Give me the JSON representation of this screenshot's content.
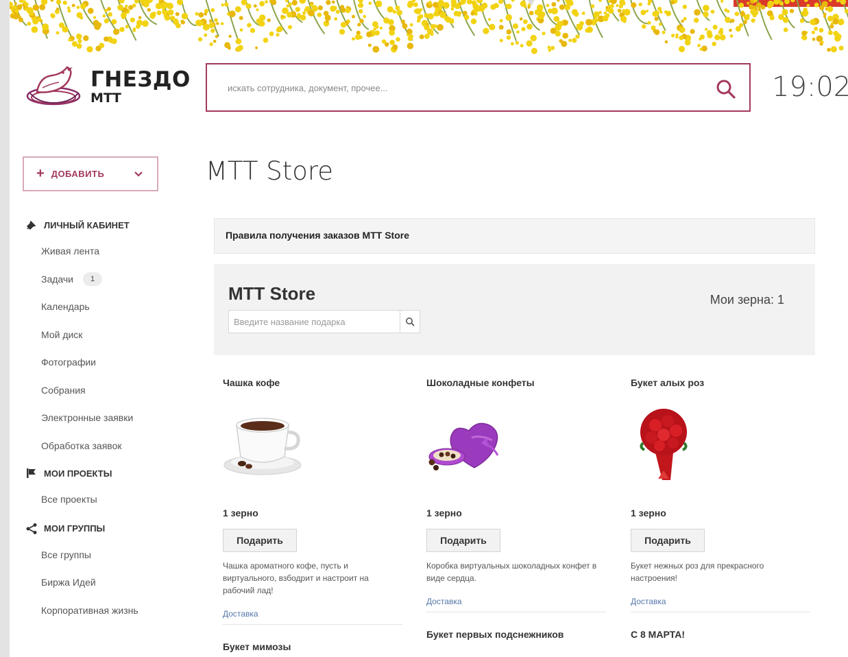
{
  "header": {
    "logo_title": "ГНЕЗДО",
    "logo_sub": "МТТ",
    "search_placeholder": "искать сотрудника, документ, прочее...",
    "clock": "19:02"
  },
  "add_button": {
    "label": "ДОБАВИТЬ",
    "plus": "+"
  },
  "sidebar": {
    "sections": [
      {
        "title": "ЛИЧНЫЙ КАБИНЕТ",
        "icon": "pin-icon",
        "items": [
          {
            "label": "Живая лента"
          },
          {
            "label": "Задачи",
            "badge": "1"
          },
          {
            "label": "Календарь"
          },
          {
            "label": "Мой диск"
          },
          {
            "label": "Фотографии"
          },
          {
            "label": "Собрания"
          },
          {
            "label": "Электронные заявки"
          },
          {
            "label": "Обработка заявок"
          }
        ]
      },
      {
        "title": "МОИ ПРОЕКТЫ",
        "icon": "flag-icon",
        "items": [
          {
            "label": "Все проекты"
          }
        ]
      },
      {
        "title": "МОИ ГРУППЫ",
        "icon": "share-icon",
        "items": [
          {
            "label": "Все группы"
          },
          {
            "label": "Биржа Идей"
          },
          {
            "label": "Корпоративная жизнь"
          }
        ]
      }
    ]
  },
  "main": {
    "page_title": "MTT Store",
    "rules_link": "Правила получения заказов МТТ Store",
    "store": {
      "title": "MTT Store",
      "search_placeholder": "Введите название подарка",
      "grains": "Мои зерна: 1"
    },
    "products": [
      {
        "name": "Чашка кофе",
        "price": "1 зерно",
        "button": "Подарить",
        "description": "Чашка ароматного кофе, пусть и виртуального, взбодрит и настроит на рабочий лад!",
        "link": "Доставка",
        "image": "coffee-cup-image"
      },
      {
        "name": "Шоколадные конфеты",
        "price": "1 зерно",
        "button": "Подарить",
        "description": "Коробка виртуальных шоколадных конфет в виде сердца.",
        "link": "Доставка",
        "image": "heart-chocolate-box-image"
      },
      {
        "name": "Букет алых роз",
        "price": "1 зерно",
        "button": "Подарить",
        "description": "Букет нежных роз для прекрасного настроения!",
        "link": "Доставка",
        "image": "red-roses-image"
      }
    ],
    "next_products": [
      {
        "name": "Букет мимозы"
      },
      {
        "name": "Букет первых подснежников"
      },
      {
        "name": "С 8 МАРТА!"
      }
    ]
  },
  "colors": {
    "accent": "#a3385e",
    "panel": "#f2f2f2",
    "link": "#5577aa",
    "banner_yellow": "#f2d313"
  }
}
